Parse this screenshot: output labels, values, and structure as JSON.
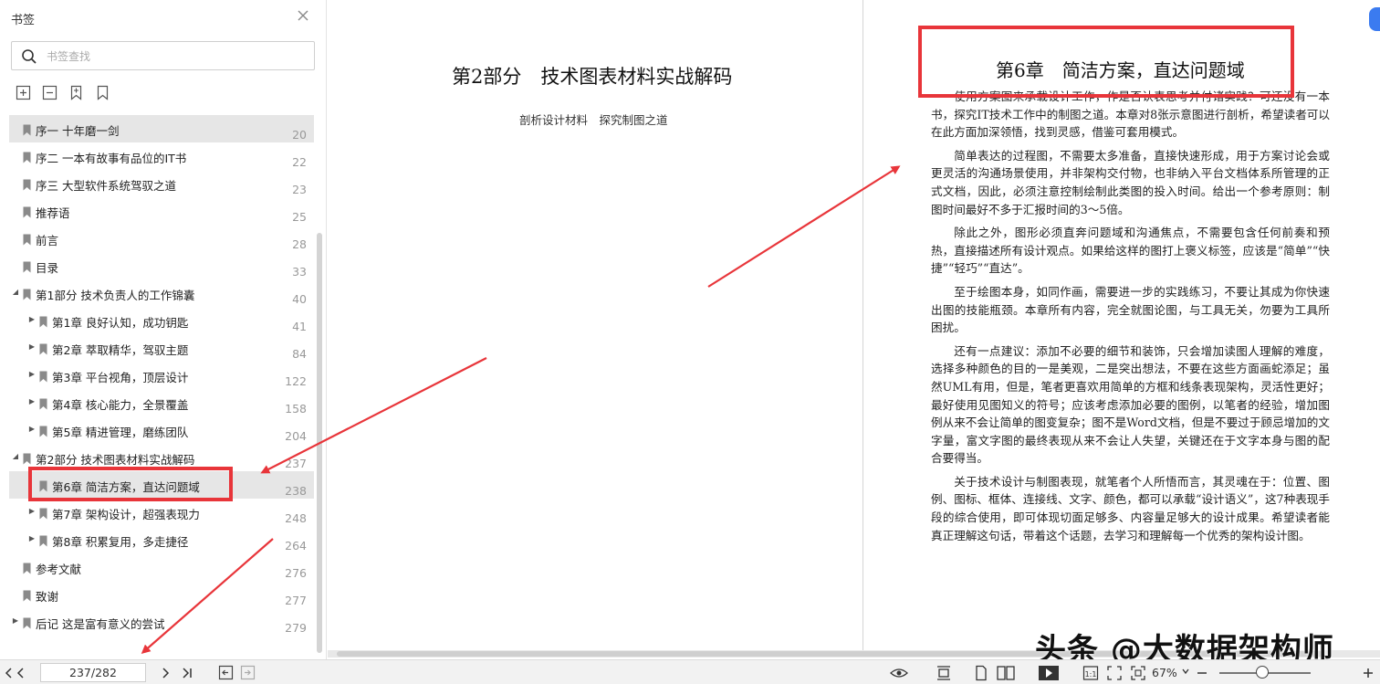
{
  "sidebar": {
    "title": "书签",
    "search_placeholder": "书签查找",
    "bookmarks": [
      {
        "label": "序一 十年磨一剑",
        "page": "20"
      },
      {
        "label": "序二 一本有故事有品位的IT书",
        "page": "22"
      },
      {
        "label": "序三 大型软件系统驾驭之道",
        "page": "23"
      },
      {
        "label": "推荐语",
        "page": "25"
      },
      {
        "label": "前言",
        "page": "28"
      },
      {
        "label": "目录",
        "page": "33"
      },
      {
        "label": "第1部分 技术负责人的工作锦囊",
        "page": "40"
      },
      {
        "label": "第1章 良好认知，成功钥匙",
        "page": "41"
      },
      {
        "label": "第2章 萃取精华，驾驭主题",
        "page": "84"
      },
      {
        "label": "第3章 平台视角，顶层设计",
        "page": "122"
      },
      {
        "label": "第4章 核心能力，全景覆盖",
        "page": "158"
      },
      {
        "label": "第5章 精进管理，磨练团队",
        "page": "204"
      },
      {
        "label": "第2部分 技术图表材料实战解码",
        "page": "237"
      },
      {
        "label": "第6章 简洁方案，直达问题域",
        "page": "238"
      },
      {
        "label": "第7章 架构设计，超强表现力",
        "page": "248"
      },
      {
        "label": "第8章 积累复用，多走捷径",
        "page": "264"
      },
      {
        "label": "参考文献",
        "page": "276"
      },
      {
        "label": "致谢",
        "page": "277"
      },
      {
        "label": "后记 这是富有意义的尝试",
        "page": "279"
      }
    ]
  },
  "doc": {
    "left_page": {
      "title": "第2部分　技术图表材料实战解码",
      "subtitle": "剖析设计材料　探究制图之道"
    },
    "right_page": {
      "chapter_title": "第6章　简洁方案，直达问题域",
      "paragraphs": [
        "使用方案图来承载设计工作，作是否认表思考并付诸实践？可还没有一本书，探究IT技术工作中的制图之道。本章对8张示意图进行剖析，希望读者可以在此方面加深领悟，找到灵感，借鉴可套用模式。",
        "简单表达的过程图，不需要太多准备，直接快速形成，用于方案讨论会或更灵活的沟通场景使用，并非架构交付物，也非纳入平台文档体系所管理的正式文档，因此，必须注意控制绘制此类图的投入时间。给出一个参考原则：制图时间最好不多于汇报时间的3～5倍。",
        "除此之外，图形必须直奔问题域和沟通焦点，不需要包含任何前奏和预热，直接描述所有设计观点。如果给这样的图打上褒义标签，应该是“简单”“快捷”“轻巧”“直达”。",
        "至于绘图本身，如同作画，需要进一步的实践练习，不要让其成为你快速出图的技能瓶颈。本章所有内容，完全就图论图，与工具无关，勿要为工具所困扰。",
        "还有一点建议：添加不必要的细节和装饰，只会增加读图人理解的难度，选择多种颜色的目的一是美观，二是突出想法，不要在这些方面画蛇添足；虽然UML有用，但是，笔者更喜欢用简单的方框和线条表现架构，灵活性更好；最好使用见图知义的符号；应该考虑添加必要的图例，以笔者的经验，增加图例从来不会让简单的图变复杂；图不是Word文档，但是不要过于顾忌增加的文字量，富文字图的最终表现从来不会让人失望，关键还在于文字本身与图的配合要得当。",
        "关于技术设计与制图表现，就笔者个人所悟而言，其灵魂在于：位置、图例、图标、框体、连接线、文字、颜色，都可以承载“设计语义”，这7种表现手段的综合使用，即可体现切面足够多、内容量足够大的设计成果。希望读者能真正理解这句话，带着这个话题，去学习和理解每一个优秀的架构设计图。"
      ]
    },
    "watermark": "头条 @大数据架构师"
  },
  "statusbar": {
    "page_indicator": "237/282",
    "zoom": "67%"
  }
}
